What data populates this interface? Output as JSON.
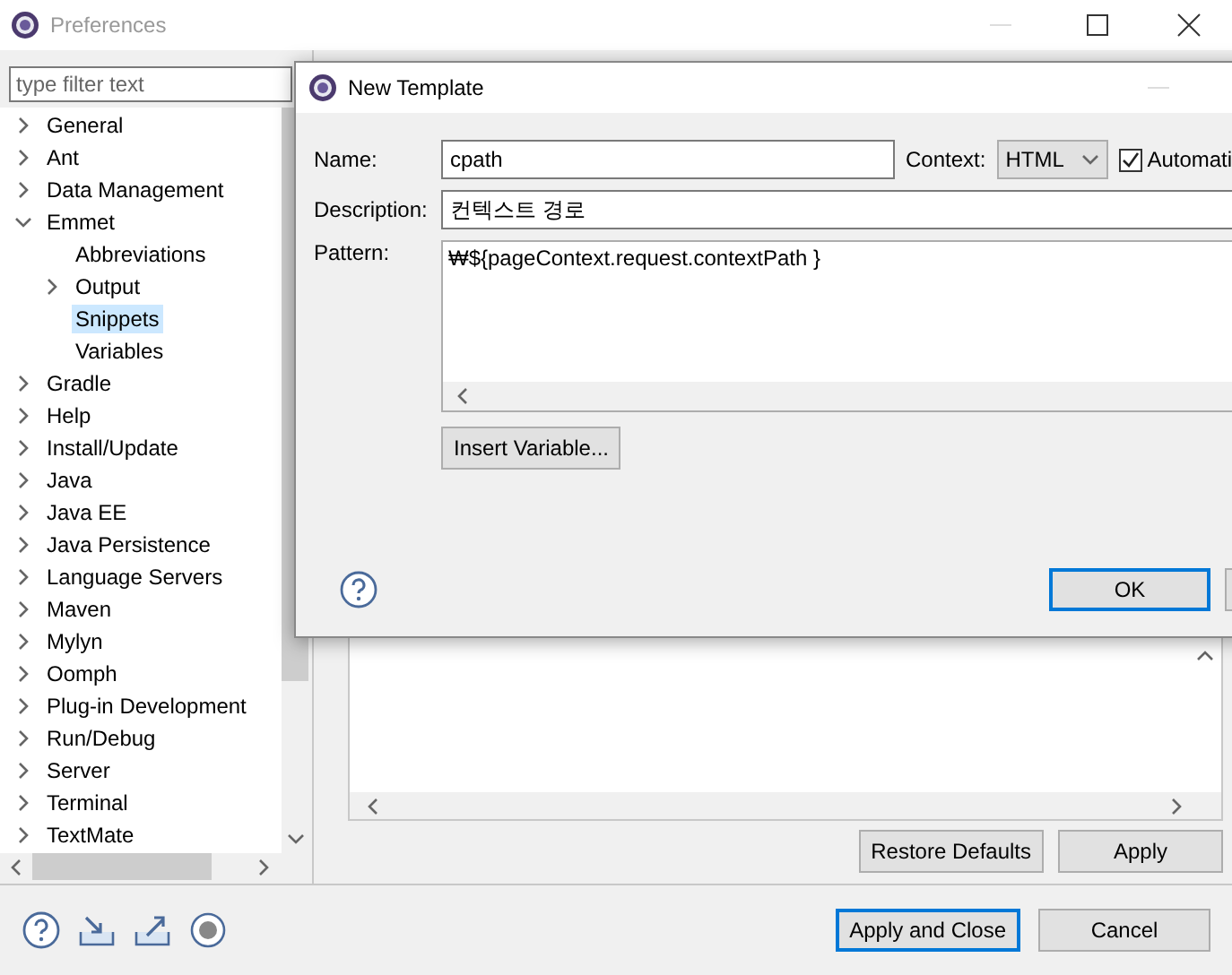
{
  "window": {
    "title": "Preferences"
  },
  "filter": {
    "placeholder": "type filter text"
  },
  "tree": [
    {
      "label": "General",
      "expanded": false,
      "selected": false
    },
    {
      "label": "Ant",
      "expanded": false,
      "selected": false
    },
    {
      "label": "Data Management",
      "expanded": false,
      "selected": false
    },
    {
      "label": "Emmet",
      "expanded": true,
      "selected": false,
      "children": [
        {
          "label": "Abbreviations",
          "selected": false
        },
        {
          "label": "Output",
          "expanded": false,
          "selected": false
        },
        {
          "label": "Snippets",
          "selected": true
        },
        {
          "label": "Variables",
          "selected": false
        }
      ]
    },
    {
      "label": "Gradle",
      "expanded": false,
      "selected": false
    },
    {
      "label": "Help",
      "expanded": false,
      "selected": false
    },
    {
      "label": "Install/Update",
      "expanded": false,
      "selected": false
    },
    {
      "label": "Java",
      "expanded": false,
      "selected": false
    },
    {
      "label": "Java EE",
      "expanded": false,
      "selected": false
    },
    {
      "label": "Java Persistence",
      "expanded": false,
      "selected": false
    },
    {
      "label": "Language Servers",
      "expanded": false,
      "selected": false
    },
    {
      "label": "Maven",
      "expanded": false,
      "selected": false
    },
    {
      "label": "Mylyn",
      "expanded": false,
      "selected": false
    },
    {
      "label": "Oomph",
      "expanded": false,
      "selected": false
    },
    {
      "label": "Plug-in Development",
      "expanded": false,
      "selected": false
    },
    {
      "label": "Run/Debug",
      "expanded": false,
      "selected": false
    },
    {
      "label": "Server",
      "expanded": false,
      "selected": false
    },
    {
      "label": "Terminal",
      "expanded": false,
      "selected": false
    },
    {
      "label": "TextMate",
      "expanded": false,
      "selected": false
    }
  ],
  "page_buttons": [
    "Restore Defaults",
    "Apply"
  ],
  "footer_buttons": [
    {
      "label": "Apply and Close",
      "default": true
    },
    {
      "label": "Cancel",
      "default": false
    }
  ],
  "dialog": {
    "title": "New Template",
    "name_label": "Name:",
    "name_value": "cpath",
    "context_label": "Context:",
    "context_value": "HTML",
    "auto_label": "Automati",
    "auto_checked": true,
    "description_label": "Description:",
    "description_value": "컨텍스트 경로",
    "pattern_label": "Pattern:",
    "pattern_value": "₩${pageContext.request.contextPath }",
    "insert_button": "Insert Variable...",
    "ok_button": "OK"
  }
}
